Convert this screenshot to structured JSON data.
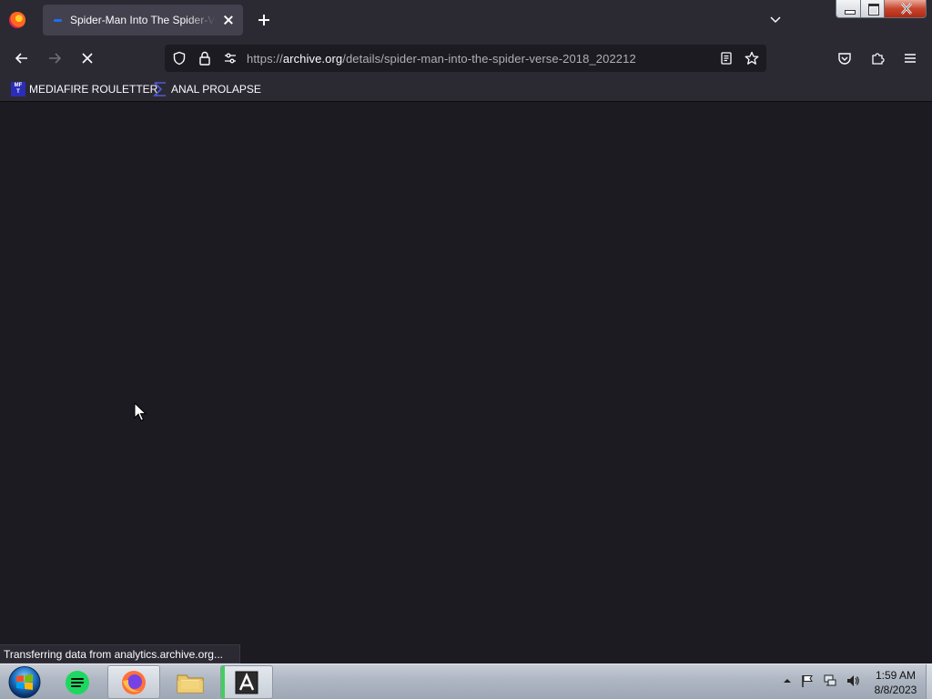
{
  "browser": {
    "tab": {
      "title": "Spider-Man Into The Spider-Verse"
    },
    "url": {
      "scheme": "https://",
      "host": "archive.org",
      "path": "/details/spider-man-into-the-spider-verse-2018_202212"
    },
    "bookmarks": [
      {
        "label": "MEDIAFIRE ROULETTER",
        "icon_text": "MF\nT"
      },
      {
        "label": "ANAL PROLAPSE",
        "icon": "sigma-icon"
      }
    ],
    "status_text": "Transferring data from analytics.archive.org...",
    "colors": {
      "chrome": "#2b2a33",
      "content": "#1c1b22",
      "urlbar": "#1c1b22",
      "text": "#fbfbfe"
    }
  },
  "taskbar": {
    "apps": [
      {
        "name": "spotify",
        "icon": "spotify-icon"
      },
      {
        "name": "firefox",
        "icon": "firefox-icon",
        "active": true
      },
      {
        "name": "file-explorer",
        "icon": "folder-icon"
      },
      {
        "name": "adobe-reader",
        "icon": "adobe-icon"
      }
    ],
    "clock": {
      "time": "1:59 AM",
      "date": "8/8/2023"
    }
  }
}
